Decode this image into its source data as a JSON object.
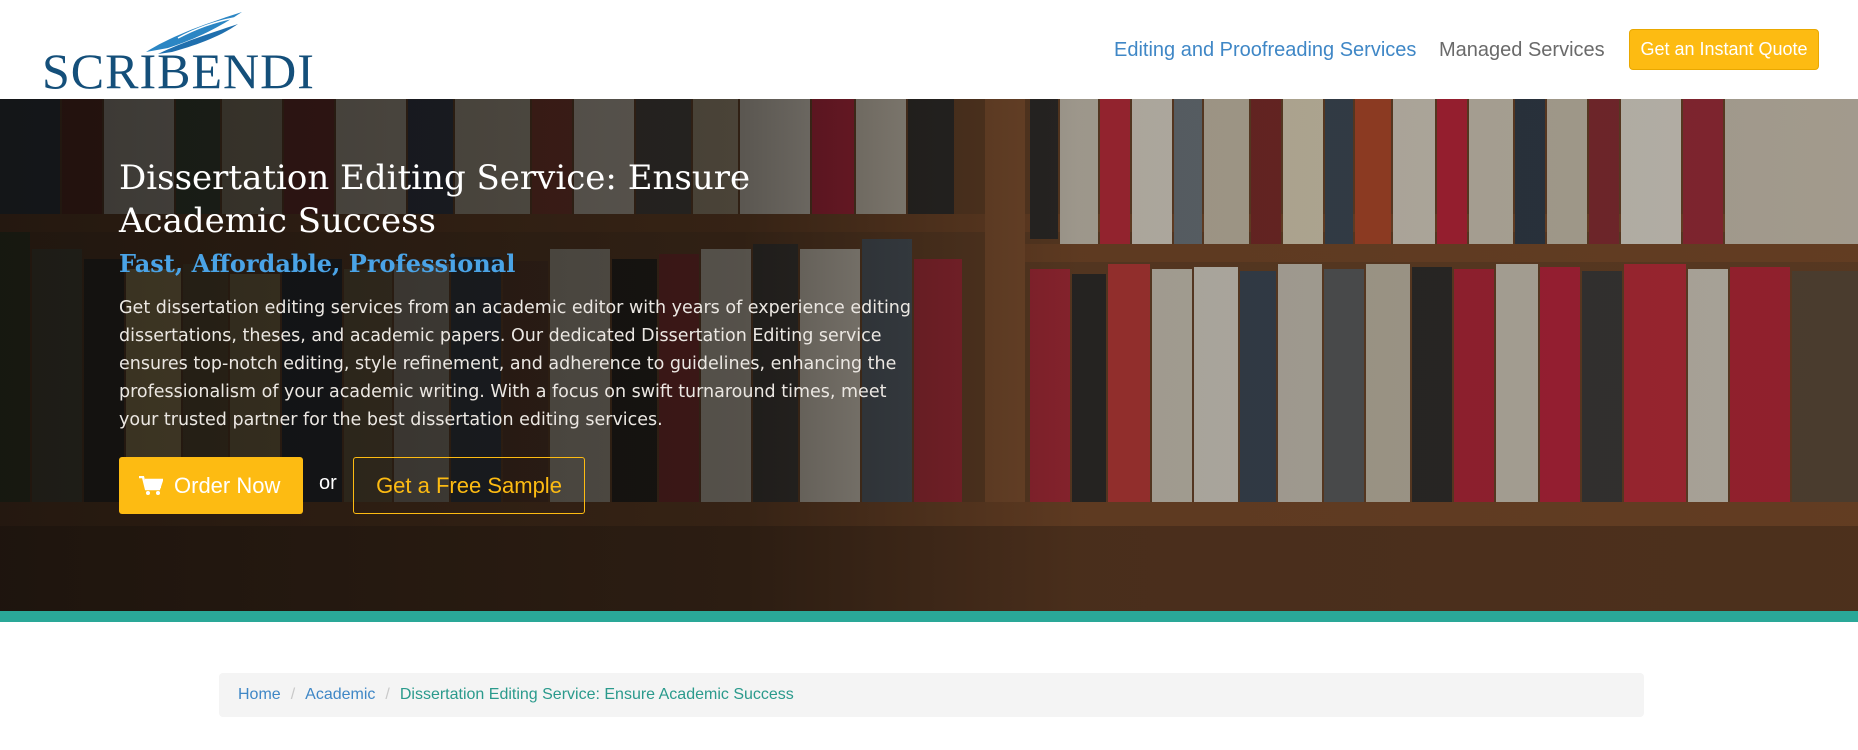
{
  "header": {
    "logo_text": "Scribendi",
    "nav": {
      "services_label": "Editing and Proofreading Services",
      "managed_label": "Managed Services",
      "quote_label": "Get an Instant Quote"
    }
  },
  "hero": {
    "title": "Dissertation Editing Service: Ensure Academic Success",
    "subtitle": "Fast, Affordable, Professional",
    "description": "Get dissertation editing services from an academic editor with years of experience editing dissertations, theses, and academic papers. Our dedicated Dissertation Editing service ensures top-notch editing, style refinement, and adherence to guidelines, enhancing the professionalism of your academic writing. With a focus on swift turnaround times, meet your trusted partner for the best dissertation editing services.",
    "order_label": "Order Now",
    "or_label": "or",
    "sample_label": "Get a Free Sample",
    "background_icon": "bookshelf-photo"
  },
  "breadcrumb": {
    "items": [
      "Home",
      "Academic",
      "Dissertation Editing Service: Ensure Academic Success"
    ],
    "separator": "/"
  },
  "colors": {
    "brand_navy": "#144f7a",
    "link_blue": "#3f87c6",
    "accent_yellow": "#fdbb12",
    "teal": "#2aa898"
  }
}
